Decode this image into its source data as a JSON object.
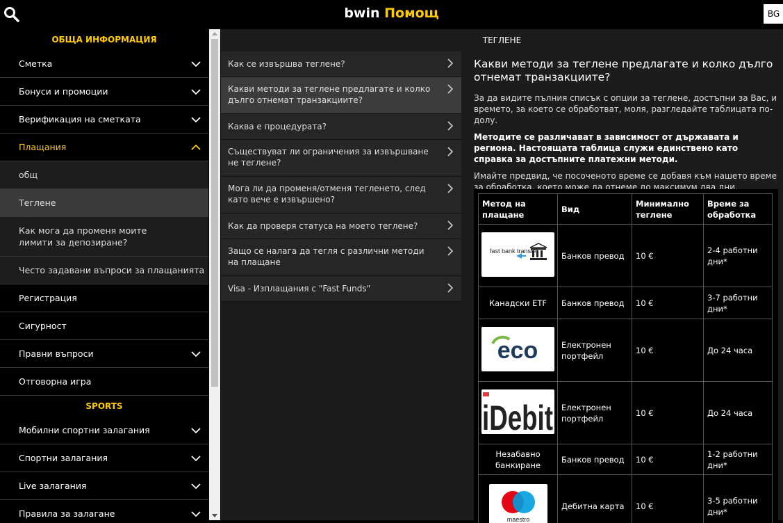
{
  "header": {
    "brand_a": "bwin",
    "brand_b": "Помощ",
    "lang": "BG",
    "accent": "#ffcc00"
  },
  "sidebar": {
    "section1": "ОБЩА ИНФОРМАЦИЯ",
    "items1": [
      {
        "label": "Сметка"
      },
      {
        "label": "Бонуси и промоции"
      },
      {
        "label": "Верификация на сметката"
      },
      {
        "label": "Плащания"
      },
      {
        "label": "общ"
      },
      {
        "label": "Теглене"
      },
      {
        "label": "Как мога да променя моите лимити за депозиране?"
      },
      {
        "label": "Често задавани въпроси за плащанията"
      },
      {
        "label": "Регистрация"
      },
      {
        "label": "Сигурност"
      },
      {
        "label": "Правни въпроси"
      },
      {
        "label": "Отговорна игра"
      }
    ],
    "section2": "SPORTS",
    "items2": [
      {
        "label": "Мобилни спортни залагания"
      },
      {
        "label": "Спортни залагания"
      },
      {
        "label": "Live залагания"
      },
      {
        "label": "Правила за залагане"
      }
    ]
  },
  "main": {
    "title": "ТЕГЛЕНЕ",
    "questions": [
      {
        "label": "Как се извършва теглене?"
      },
      {
        "label": "Какви методи за теглене предлагате и колко дълго отнемат транзакциите?"
      },
      {
        "label": "Каква е процедурата?"
      },
      {
        "label": "Съществуват ли ограничения за извършване не теглене?"
      },
      {
        "label": "Мога ли да променя/отменя тегленето, след като вече е извършено?"
      },
      {
        "label": "Как да проверя статуса на моето теглене?"
      },
      {
        "label": "Защо се налага да тегля с различни методи на плащане"
      },
      {
        "label": "Visa - Изплащания с \"Fast Funds\""
      }
    ],
    "answer": {
      "heading": "Какви методи за теглене предлагате и колко дълго отнемат транзакциите?",
      "p1": "За да видите пълния списък с опции за теглене, достъпни за Вас, и времето, за което се обработват, моля, разгледайте таблицата по-долу.",
      "p2": "Методите се различават в зависимост от държавата и региона. Настоящата таблица служи единствено като справка за достъпните платежни методи.",
      "p3": "Имайте предвид, че посоченото време се добавя към нашето време за обработка, което може да отнеме до максимум два дни."
    },
    "table": {
      "headers": [
        "Метод на плащане",
        "Вид",
        "Минимално теглене",
        "Време за обработка"
      ],
      "rows": [
        {
          "method_logo_text": "fast bank transfer",
          "method": "",
          "type": "Банков превод",
          "min": "10 €",
          "time": "2-4 работни дни*"
        },
        {
          "method_logo_text": "",
          "method": "Канадски ETF",
          "type": "Банков превод",
          "min": "10 €",
          "time": "3-7 работни дни*"
        },
        {
          "method_logo_text": "eco",
          "method": "",
          "type": "Електронен портфейл",
          "min": "10 €",
          "time": "До 24 часа"
        },
        {
          "method_logo_text": "iDebit",
          "method": "",
          "type": "Електронен портфейл",
          "min": "10 €",
          "time": "До 24 часа"
        },
        {
          "method_logo_text": "",
          "method": "Незабавно банкиране",
          "type": "Банков превод",
          "min": "10 €",
          "time": "1-2 работни дни*"
        },
        {
          "method_logo_text": "maestro",
          "method": "",
          "type": "Дебитна карта",
          "min": "10 €",
          "time": "3-5 работни дни*"
        }
      ]
    }
  }
}
